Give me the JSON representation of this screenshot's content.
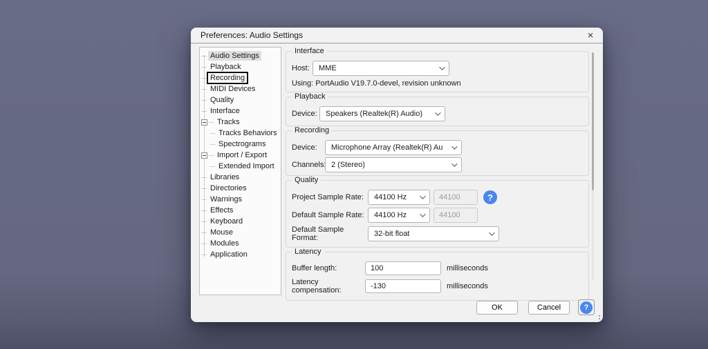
{
  "window": {
    "title": "Preferences: Audio Settings",
    "close_icon": "×"
  },
  "sidebar": {
    "items": [
      {
        "label": "Audio Settings",
        "state": "selected"
      },
      {
        "label": "Playback"
      },
      {
        "label": "Recording",
        "state": "focus-box"
      },
      {
        "label": "MIDI Devices"
      },
      {
        "label": "Quality"
      },
      {
        "label": "Interface"
      },
      {
        "label": "Tracks",
        "expander": true
      },
      {
        "label": "Tracks Behaviors",
        "level": 1
      },
      {
        "label": "Spectrograms",
        "level": 1
      },
      {
        "label": "Import / Export",
        "expander": true
      },
      {
        "label": "Extended Import",
        "level": 1
      },
      {
        "label": "Libraries"
      },
      {
        "label": "Directories"
      },
      {
        "label": "Warnings"
      },
      {
        "label": "Effects"
      },
      {
        "label": "Keyboard"
      },
      {
        "label": "Mouse"
      },
      {
        "label": "Modules"
      },
      {
        "label": "Application"
      }
    ]
  },
  "sections": {
    "interface": {
      "title": "Interface",
      "host_label": "Host:",
      "host_value": "MME",
      "using_text": "Using: PortAudio V19.7.0-devel, revision unknown"
    },
    "playback": {
      "title": "Playback",
      "device_label": "Device:",
      "device_value": "Speakers (Realtek(R) Audio)"
    },
    "recording": {
      "title": "Recording",
      "device_label": "Device:",
      "device_value": "Microphone Array (Realtek(R) Au",
      "channels_label": "Channels:",
      "channels_value": "2 (Stereo)"
    },
    "quality": {
      "title": "Quality",
      "project_rate_label": "Project Sample Rate:",
      "project_rate_value": "44100 Hz",
      "project_rate_other": "44100",
      "default_rate_label": "Default Sample Rate:",
      "default_rate_value": "44100 Hz",
      "default_rate_other": "44100",
      "format_label": "Default Sample Format:",
      "format_value": "32-bit float",
      "help_icon": "?"
    },
    "latency": {
      "title": "Latency",
      "buffer_label": "Buffer length:",
      "buffer_value": "100",
      "buffer_unit": "milliseconds",
      "comp_label": "Latency compensation:",
      "comp_value": "-130",
      "comp_unit": "milliseconds"
    }
  },
  "footer": {
    "ok_label": "OK",
    "cancel_label": "Cancel",
    "help_icon": "?"
  },
  "colors": {
    "accent_blue": "#4a86f0",
    "desktop_background": "#656880",
    "dialog_background": "#f1f1f1"
  }
}
